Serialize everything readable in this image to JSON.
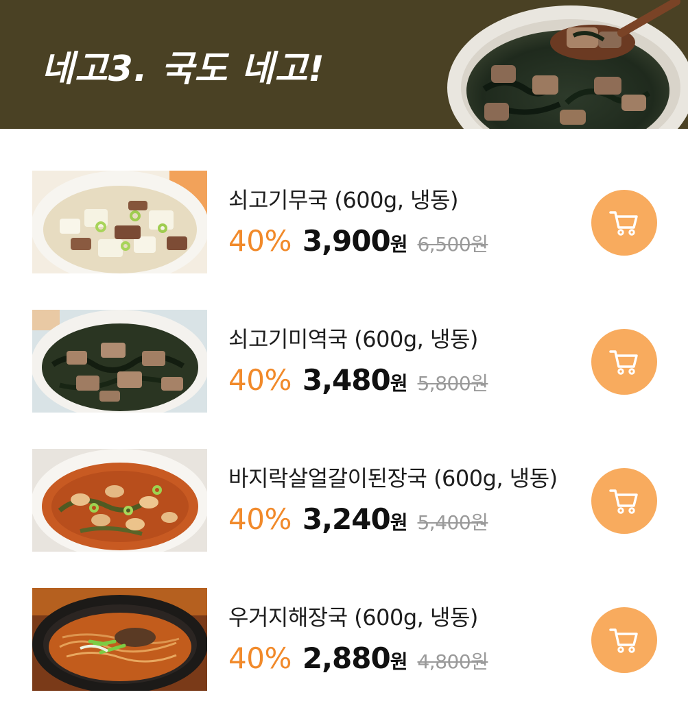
{
  "banner": {
    "title": "네고3. 국도 네고!"
  },
  "colors": {
    "banner_bg": "#4a4124",
    "discount": "#f18a2b",
    "cart_button": "#f8ab5e"
  },
  "products": [
    {
      "name": "쇠고기무국 (600g, 냉동)",
      "discount": "40%",
      "price": "3,900",
      "currency": "원",
      "original_price": "6,500원",
      "image": "beef-radish-soup",
      "cart_icon": "cart-icon"
    },
    {
      "name": "쇠고기미역국 (600g, 냉동)",
      "discount": "40%",
      "price": "3,480",
      "currency": "원",
      "original_price": "5,800원",
      "image": "beef-seaweed-soup",
      "cart_icon": "cart-icon"
    },
    {
      "name": "바지락살얼갈이된장국 (600g, 냉동)",
      "discount": "40%",
      "price": "3,240",
      "currency": "원",
      "original_price": "5,400원",
      "image": "clam-soybean-paste-soup",
      "cart_icon": "cart-icon"
    },
    {
      "name": "우거지해장국 (600g, 냉동)",
      "discount": "40%",
      "price": "2,880",
      "currency": "원",
      "original_price": "4,800원",
      "image": "hangover-soup",
      "cart_icon": "cart-icon"
    }
  ]
}
